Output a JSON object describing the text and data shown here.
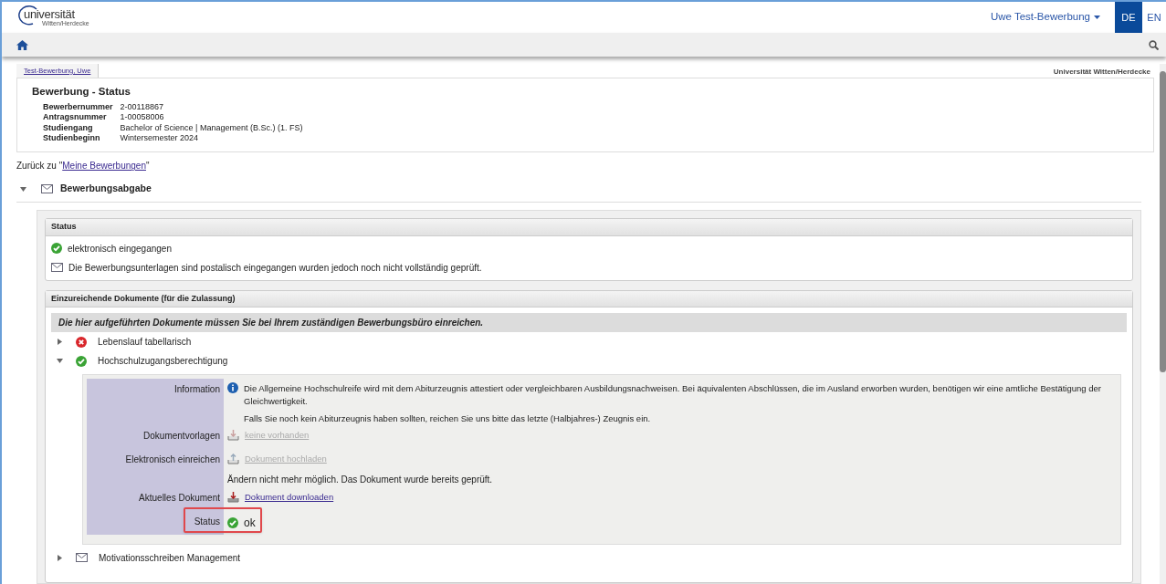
{
  "header": {
    "logo": {
      "word": "universität",
      "sub": "Witten/Herdecke"
    },
    "user_menu": "Uwe Test-Bewerbung",
    "languages": [
      {
        "label": "DE",
        "selected": true
      },
      {
        "label": "EN",
        "selected": false
      }
    ]
  },
  "page_tab": "Test-Bewerbung, Uwe",
  "organisation": "Universität Witten/Herdecke",
  "title": "Bewerbung - Status",
  "fields": [
    {
      "label": "Bewerbernummer",
      "value": "2-00118867"
    },
    {
      "label": "Antragsnummer",
      "value": "1-00058006"
    },
    {
      "label": "Studiengang",
      "value": "Bachelor of Science | Management (B.Sc.) (1. FS)"
    },
    {
      "label": "Studienbeginn",
      "value": "Wintersemester 2024"
    }
  ],
  "back_link": {
    "prefix": "Zurück zu \"",
    "link": "Meine Bewerbungen",
    "suffix": "\""
  },
  "section": {
    "title": "Bewerbungsabgabe",
    "expanded": true
  },
  "status_panel": {
    "title": "Status",
    "items": [
      {
        "kind": "ok",
        "text": "elektronisch eingegangen"
      },
      {
        "kind": "mail",
        "text": "Die Bewerbungsunterlagen sind postalisch eingegangen wurden jedoch noch nicht vollständig geprüft."
      }
    ]
  },
  "documents_panel": {
    "title": "Einzureichende Dokumente (für die Zulassung)",
    "notice": "Die hier aufgeführten Dokumente müssen Sie bei Ihrem zuständigen Bewerbungsbüro einreichen.",
    "items": [
      {
        "kind": "error",
        "label": "Lebenslauf tabellarisch",
        "expanded": false
      },
      {
        "kind": "ok",
        "label": "Hochschulzugangsberechtigung",
        "expanded": true,
        "details": [
          {
            "label": "Information",
            "kind": "info",
            "paragraphs": [
              "Die Allgemeine Hochschulreife wird mit dem Abiturzeugnis attestiert oder vergleichbaren Ausbildungsnachweisen. Bei äquivalenten Abschlüssen, die im Ausland erworben wurden, benötigen wir eine amtliche Bestätigung der Gleichwertigkeit.",
              "Falls Sie noch kein Abiturzeugnis haben sollten, reichen Sie uns bitte das letzte (Halbjahres-) Zeugnis ein."
            ]
          },
          {
            "label": "Dokumentvorlagen",
            "kind": "download",
            "link": "keine vorhanden",
            "disabled": true
          },
          {
            "label": "Elektronisch einreichen",
            "kind": "upload",
            "link": "Dokument hochladen",
            "disabled": true,
            "note": "Ändern nicht mehr möglich. Das Dokument wurde bereits geprüft."
          },
          {
            "label": "Aktuelles Dokument",
            "kind": "download",
            "link": "Dokument downloaden",
            "disabled": false
          },
          {
            "label": "Status",
            "kind": "ok",
            "text": "ok",
            "highlighted": true
          }
        ]
      },
      {
        "kind": "mail",
        "label": "Motivationsschreiben Management",
        "expanded": false
      }
    ]
  }
}
